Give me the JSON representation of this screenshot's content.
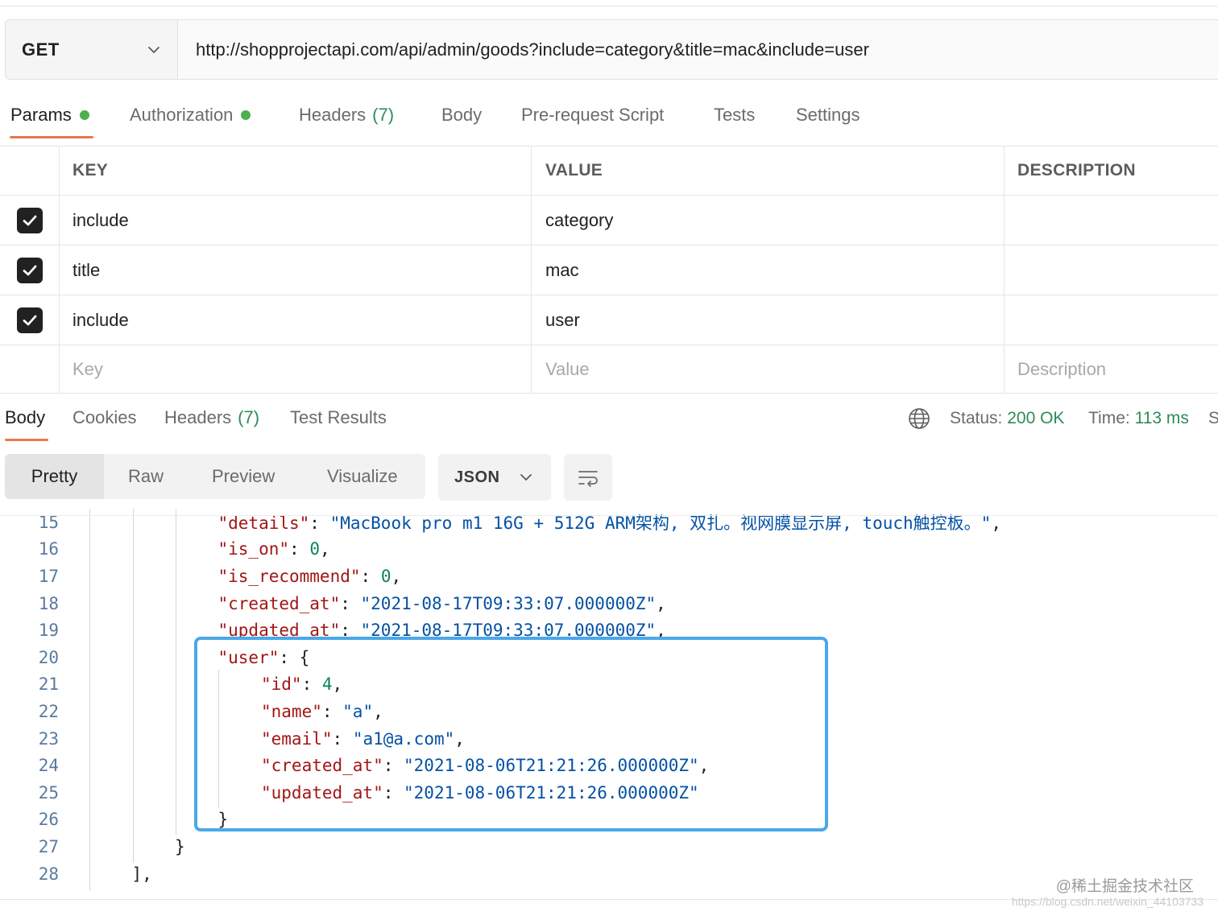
{
  "request": {
    "method": "GET",
    "url": "http://shopprojectapi.com/api/admin/goods?include=category&title=mac&include=user"
  },
  "request_tabs": {
    "params": "Params",
    "authorization": "Authorization",
    "headers": "Headers",
    "headers_count": "(7)",
    "body": "Body",
    "prerequest": "Pre-request Script",
    "tests": "Tests",
    "settings": "Settings"
  },
  "params_table": {
    "headers": [
      "KEY",
      "VALUE",
      "DESCRIPTION"
    ],
    "rows": [
      {
        "checked": true,
        "key": "include",
        "value": "category",
        "description": ""
      },
      {
        "checked": true,
        "key": "title",
        "value": "mac",
        "description": ""
      },
      {
        "checked": true,
        "key": "include",
        "value": "user",
        "description": ""
      }
    ],
    "placeholders": {
      "key": "Key",
      "value": "Value",
      "description": "Description"
    }
  },
  "response_tabs": {
    "body": "Body",
    "cookies": "Cookies",
    "headers": "Headers",
    "headers_count": "(7)",
    "test_results": "Test Results"
  },
  "response_status": {
    "status_label": "Status:",
    "status_value": "200 OK",
    "time_label": "Time:",
    "time_value": "113 ms",
    "truncated": "S"
  },
  "view_modes": {
    "pretty": "Pretty",
    "raw": "Raw",
    "preview": "Preview",
    "visualize": "Visualize",
    "format": "JSON"
  },
  "code_lines": [
    {
      "num": "15",
      "indent": 3,
      "tokens": [
        [
          "k",
          "\"details\""
        ],
        [
          "p",
          ": "
        ],
        [
          "s",
          "\"MacBook pro m1 16G + 512G ARM架构, 双扎。视网膜显示屏, touch触控板。\""
        ],
        [
          "p",
          ","
        ]
      ]
    },
    {
      "num": "16",
      "indent": 3,
      "tokens": [
        [
          "k",
          "\"is_on\""
        ],
        [
          "p",
          ": "
        ],
        [
          "n",
          "0"
        ],
        [
          "p",
          ","
        ]
      ]
    },
    {
      "num": "17",
      "indent": 3,
      "tokens": [
        [
          "k",
          "\"is_recommend\""
        ],
        [
          "p",
          ": "
        ],
        [
          "n",
          "0"
        ],
        [
          "p",
          ","
        ]
      ]
    },
    {
      "num": "18",
      "indent": 3,
      "tokens": [
        [
          "k",
          "\"created_at\""
        ],
        [
          "p",
          ": "
        ],
        [
          "s",
          "\"2021-08-17T09:33:07.000000Z\""
        ],
        [
          "p",
          ","
        ]
      ]
    },
    {
      "num": "19",
      "indent": 3,
      "tokens": [
        [
          "k",
          "\"updated_at\""
        ],
        [
          "p",
          ": "
        ],
        [
          "s",
          "\"2021-08-17T09:33:07.000000Z\""
        ],
        [
          "p",
          ","
        ]
      ]
    },
    {
      "num": "20",
      "indent": 3,
      "tokens": [
        [
          "k",
          "\"user\""
        ],
        [
          "p",
          ": {"
        ]
      ]
    },
    {
      "num": "21",
      "indent": 4,
      "tokens": [
        [
          "k",
          "\"id\""
        ],
        [
          "p",
          ": "
        ],
        [
          "n",
          "4"
        ],
        [
          "p",
          ","
        ]
      ]
    },
    {
      "num": "22",
      "indent": 4,
      "tokens": [
        [
          "k",
          "\"name\""
        ],
        [
          "p",
          ": "
        ],
        [
          "s",
          "\"a\""
        ],
        [
          "p",
          ","
        ]
      ]
    },
    {
      "num": "23",
      "indent": 4,
      "tokens": [
        [
          "k",
          "\"email\""
        ],
        [
          "p",
          ": "
        ],
        [
          "s",
          "\"a1@a.com\""
        ],
        [
          "p",
          ","
        ]
      ]
    },
    {
      "num": "24",
      "indent": 4,
      "tokens": [
        [
          "k",
          "\"created_at\""
        ],
        [
          "p",
          ": "
        ],
        [
          "s",
          "\"2021-08-06T21:21:26.000000Z\""
        ],
        [
          "p",
          ","
        ]
      ]
    },
    {
      "num": "25",
      "indent": 4,
      "tokens": [
        [
          "k",
          "\"updated_at\""
        ],
        [
          "p",
          ": "
        ],
        [
          "s",
          "\"2021-08-06T21:21:26.000000Z\""
        ]
      ]
    },
    {
      "num": "26",
      "indent": 3,
      "tokens": [
        [
          "p",
          "}"
        ]
      ]
    },
    {
      "num": "27",
      "indent": 2,
      "tokens": [
        [
          "p",
          "}"
        ]
      ]
    },
    {
      "num": "28",
      "indent": 1,
      "tokens": [
        [
          "p",
          "],"
        ]
      ]
    }
  ],
  "watermark": "@稀土掘金技术社区",
  "watermark_url": "https://blog.csdn.net/weixin_44103733",
  "colors": {
    "accent": "#e8784c",
    "success": "#2e8b57",
    "dot": "#4caf50",
    "highlight": "#4aa8e8",
    "json_key": "#a31515",
    "json_string": "#0451a5",
    "json_number": "#098658"
  },
  "icons": {
    "method_dropdown": "chevron-down-icon",
    "format_dropdown": "chevron-down-icon",
    "network": "globe-icon",
    "wrap": "wrap-lines-icon",
    "checkbox": "checkmark-icon"
  }
}
